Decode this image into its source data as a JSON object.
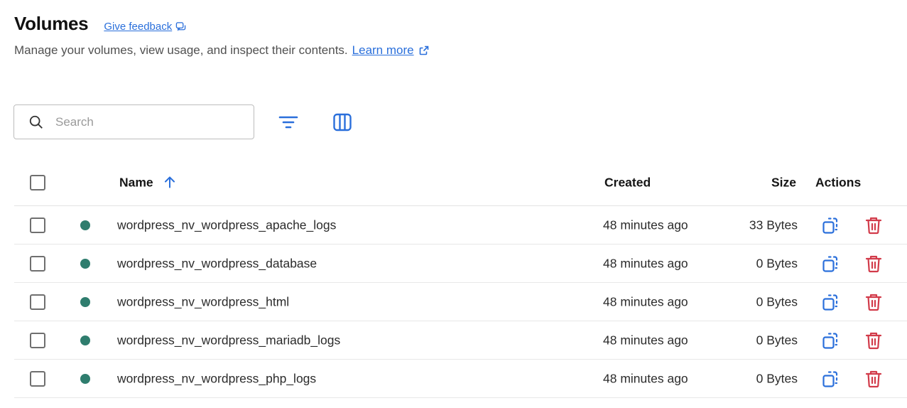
{
  "header": {
    "title": "Volumes",
    "feedback_label": "Give feedback",
    "subtitle": "Manage your volumes, view usage, and inspect their contents.",
    "learn_more_label": "Learn more"
  },
  "toolbar": {
    "search_placeholder": "Search",
    "search_value": ""
  },
  "table": {
    "columns": {
      "name": "Name",
      "created": "Created",
      "size": "Size",
      "actions": "Actions"
    },
    "sort": {
      "column": "Name",
      "direction": "ascending"
    },
    "rows": [
      {
        "name": "wordpress_nv_wordpress_apache_logs",
        "created": "48 minutes ago",
        "size": "33 Bytes",
        "in_use": true
      },
      {
        "name": "wordpress_nv_wordpress_database",
        "created": "48 minutes ago",
        "size": "0 Bytes",
        "in_use": true
      },
      {
        "name": "wordpress_nv_wordpress_html",
        "created": "48 minutes ago",
        "size": "0 Bytes",
        "in_use": true
      },
      {
        "name": "wordpress_nv_wordpress_mariadb_logs",
        "created": "48 minutes ago",
        "size": "0 Bytes",
        "in_use": true
      },
      {
        "name": "wordpress_nv_wordpress_php_logs",
        "created": "48 minutes ago",
        "size": "0 Bytes",
        "in_use": true
      }
    ]
  },
  "colors": {
    "accent": "#2a6fdb",
    "in_use_dot": "#2f7d6e",
    "delete": "#d23b4a",
    "border": "#bdbdbd"
  },
  "icons": {
    "feedback": "feedback-icon",
    "external_link": "external-link-icon",
    "search": "search-icon",
    "filter": "filter-icon",
    "columns": "columns-icon",
    "sort": "sort-arrow-up-icon",
    "clone": "clone-icon",
    "delete": "trash-icon"
  }
}
